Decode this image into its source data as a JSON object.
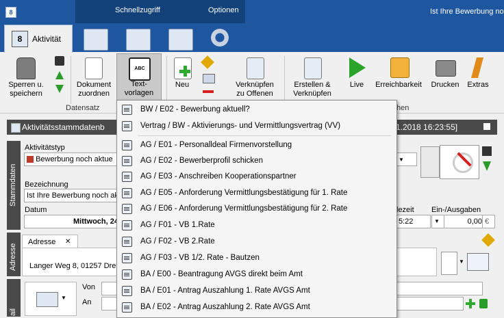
{
  "title_bar": {
    "quick_access": "Schnellzugriff",
    "options": "Optionen",
    "window_title": "Ist Ihre Bewerbung no"
  },
  "tabs": [
    {
      "label": "Aktivität",
      "active": true
    }
  ],
  "ribbon": {
    "groups": {
      "datensatz": "Datensatz",
      "partial_right": "hen"
    },
    "buttons": {
      "sperren": "Sperren u.\nspeichern",
      "dokument": "Dokument\nzuordnen",
      "textvorlagen": "Text-\nvorlagen",
      "neu": "Neu",
      "verknuepfen": "Verknüpfen\nzu Offenen",
      "erstellen": "Erstellen &\nVerknüpfen",
      "live": "Live",
      "erreichbarkeit": "Erreichbarkeit",
      "drucken": "Drucken",
      "extras": "Extras"
    }
  },
  "panel": {
    "title": "Aktivitätsstammdatenb",
    "date_partial": "1.2018 16:23:55]"
  },
  "sections": {
    "stammdaten": "Stammdaten",
    "adresse": "Adresse",
    "mail": "ail"
  },
  "form": {
    "aktivitaetstyp_label": "Aktivitätstyp",
    "aktivitaetstyp_value": "Bewerbung noch aktue",
    "bezeichnung_label": "Bezeichnung",
    "bezeichnung_value": "Ist Ihre Bewerbung noch ak",
    "datum_label": "Datum",
    "datum_value": "Mittwoch, 24",
    "zeit_label": "lezeit",
    "zeit_value": "5:22",
    "ein_aus_label": "Ein-/Ausgaben",
    "ein_aus_value": "0,00",
    "currency": "€",
    "adresse_tab": "Adresse",
    "adresse_close": "✕",
    "adresse_value": "Langer Weg 8, 01257 Dre",
    "von_label": "Von",
    "an_label": "An"
  },
  "dropdown": {
    "items": [
      "BW / E02 - Bewerbung aktuell?",
      "Vertrag / BW - Aktivierungs- und Vermittlungsvertrag (VV)",
      "AG / E01 - Personalldeal Firmenvorstellung",
      "AG / E02 - Bewerberprofil schicken",
      "AG / E03 - Anschreiben Kooperationspartner",
      "AG / E05 - Anforderung Vermittlungsbestätigung für 1. Rate",
      "AG / E06 - Anforderung Vermittlungsbestätigung für 2. Rate",
      "AG / F01 - VB 1.Rate",
      "AG / F02 - VB 2.Rate",
      "AG / F03 - VB 1/2. Rate - Bautzen",
      "BA / E00 - Beantragung AVGS direkt beim Amt",
      "BA / E01 - Antrag Auszahlung 1. Rate AVGS Amt",
      "BA / E02 - Antrag Auszahlung 2. Rate AVGS Amt"
    ]
  }
}
